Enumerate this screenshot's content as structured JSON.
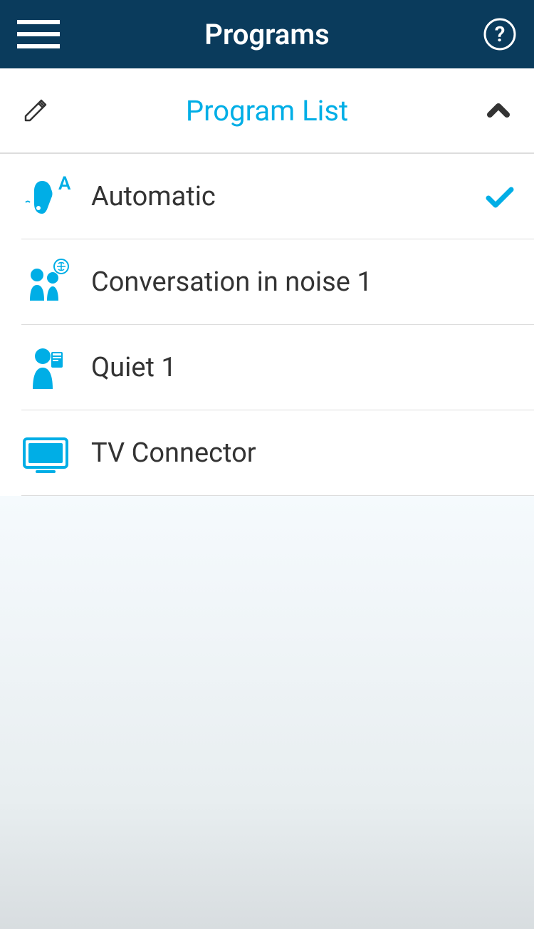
{
  "header": {
    "title": "Programs"
  },
  "subheader": {
    "title": "Program List"
  },
  "programs": [
    {
      "label": "Automatic",
      "icon": "automatic",
      "selected": true
    },
    {
      "label": "Conversation in noise 1",
      "icon": "conversation",
      "selected": false
    },
    {
      "label": "Quiet 1",
      "icon": "quiet",
      "selected": false
    },
    {
      "label": "TV Connector",
      "icon": "tv",
      "selected": false
    }
  ],
  "colors": {
    "headerBg": "#0a3b5c",
    "accent": "#00aee6",
    "text": "#333"
  }
}
